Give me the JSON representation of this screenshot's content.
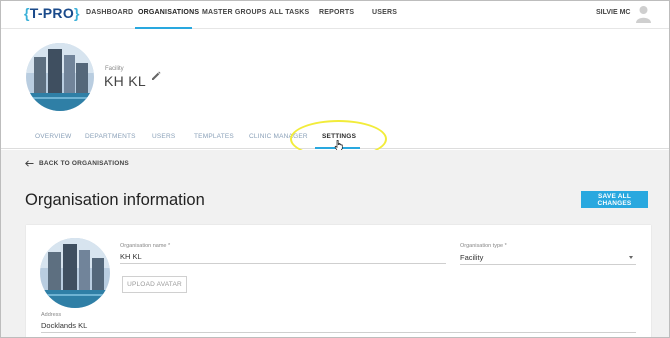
{
  "nav": {
    "logo_open": "{",
    "logo_text": "T-PRO",
    "logo_close": "}",
    "items": [
      "DASHBOARD",
      "ORGANISATIONS",
      "MASTER GROUPS",
      "ALL TASKS",
      "REPORTS",
      "USERS"
    ],
    "active": "ORGANISATIONS",
    "user_name": "SILVIE MC"
  },
  "profile": {
    "type_label": "Facility",
    "name": "KH KL"
  },
  "tabs": [
    "OVERVIEW",
    "DEPARTMENTS",
    "USERS",
    "TEMPLATES",
    "CLINIC MANAGER",
    "SETTINGS"
  ],
  "active_tab": "SETTINGS",
  "back_link": "BACK TO ORGANISATIONS",
  "section_title": "Organisation information",
  "save_button": "SAVE ALL CHANGES",
  "form": {
    "org_name_label": "Organisation name *",
    "org_name_value": "KH KL",
    "org_type_label": "Organisation type *",
    "org_type_value": "Facility",
    "upload_button": "UPLOAD AVATAR",
    "address_label": "Address",
    "address_value": "Docklands KL"
  },
  "colors": {
    "accent": "#29a8df",
    "logo_blue": "#1a4a8a",
    "highlight": "#f2ec3a",
    "content_bg": "#f1f1f1"
  },
  "icons": [
    "pencil-icon",
    "back-arrow-icon",
    "user-avatar-icon",
    "pointer-cursor-icon",
    "dropdown-arrow-icon"
  ]
}
